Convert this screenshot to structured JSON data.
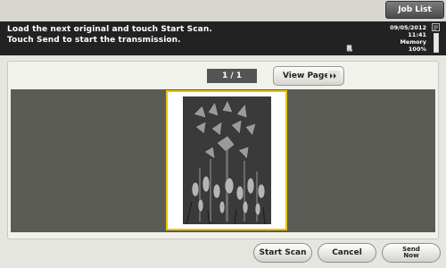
{
  "header": {
    "job_list_label": "Job List"
  },
  "message": {
    "line1": "Load the next original and touch Start Scan.",
    "line2": "Touch Send to start the transmission."
  },
  "status": {
    "date": "09/05/2012",
    "time": "11:41",
    "memory_label": "Memory",
    "memory_value": "100%",
    "memory_fraction": 1.0
  },
  "preview": {
    "page_counter": "1 / 1",
    "view_page_label": "View Page"
  },
  "footer": {
    "start_scan_label": "Start Scan",
    "cancel_label": "Cancel",
    "send_line1": "Send",
    "send_line2": "Now"
  },
  "colors": {
    "selection_border": "#e8c200",
    "message_bar": "#222222"
  },
  "icons": {
    "view_page_arrow": "double-chevron-right-icon",
    "scan_status": "scan-document-icon",
    "status_top": "fax-status-icon",
    "memory_gauge": "memory-gauge-icon"
  }
}
